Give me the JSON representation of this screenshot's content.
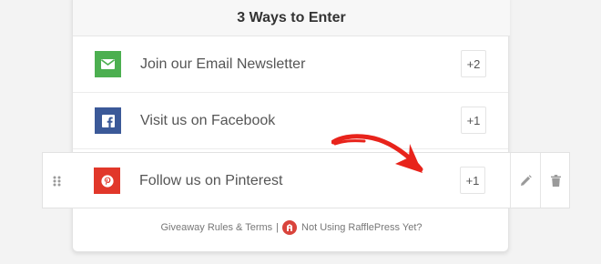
{
  "card": {
    "title": "3 Ways to Enter"
  },
  "entries": [
    {
      "label": "Join our Email Newsletter",
      "points": "+2",
      "icon": "envelope-icon",
      "color": "#4caf50"
    },
    {
      "label": "Visit us on Facebook",
      "points": "+1",
      "icon": "facebook-icon",
      "color": "#3b5998"
    },
    {
      "label": "Follow us on Pinterest",
      "points": "+1",
      "icon": "pinterest-icon",
      "color": "#e1372a"
    }
  ],
  "row_tools": {
    "edit_icon": "pencil-icon",
    "delete_icon": "trash-icon"
  },
  "footer": {
    "rules_link": "Giveaway Rules & Terms",
    "separator": "|",
    "promo_link": "Not Using RafflePress Yet?"
  },
  "annotation": {
    "arrow_color": "#e8231b"
  }
}
